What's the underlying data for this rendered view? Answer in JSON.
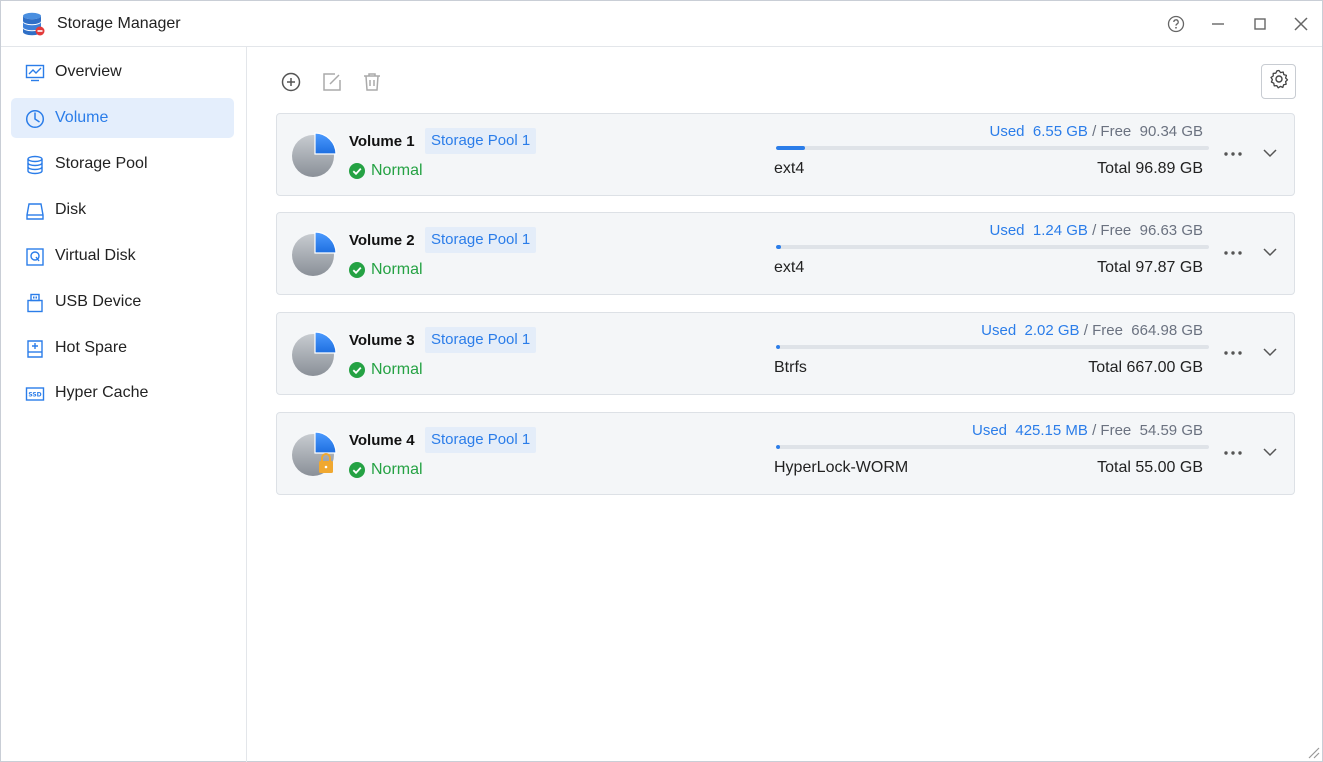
{
  "app": {
    "title": "Storage Manager",
    "icon": "database-icon"
  },
  "window_controls": {
    "help": "help-icon",
    "minimize": "minimize-icon",
    "maximize": "maximize-icon",
    "close": "close-icon"
  },
  "sidebar": {
    "items": [
      {
        "label": "Overview",
        "icon": "monitor-chart-icon",
        "active": false
      },
      {
        "label": "Volume",
        "icon": "pie-clock-icon",
        "active": true
      },
      {
        "label": "Storage Pool",
        "icon": "database-icon",
        "active": false
      },
      {
        "label": "Disk",
        "icon": "hard-drive-icon",
        "active": false
      },
      {
        "label": "Virtual Disk",
        "icon": "virtual-disk-icon",
        "active": false
      },
      {
        "label": "USB Device",
        "icon": "usb-icon",
        "active": false
      },
      {
        "label": "Hot Spare",
        "icon": "hot-spare-icon",
        "active": false
      },
      {
        "label": "Hyper Cache",
        "icon": "ssd-icon",
        "active": false
      }
    ]
  },
  "toolbar": {
    "add": "add-circle-icon",
    "edit": "edit-icon",
    "delete": "trash-icon",
    "settings": "gear-icon"
  },
  "colors": {
    "accent": "#2b7de9",
    "status_ok": "#25a244",
    "active_bg": "#e4eefc"
  },
  "volumes": [
    {
      "name": "Volume 1",
      "pool": "Storage Pool 1",
      "status": "Normal",
      "used_label": "Used",
      "used": "6.55 GB",
      "sep": "/",
      "free_label": "Free",
      "free": "90.34 GB",
      "fs": "ext4",
      "total_label": "Total",
      "total": "96.89 GB",
      "used_fraction": 0.0676,
      "locked": false
    },
    {
      "name": "Volume 2",
      "pool": "Storage Pool 1",
      "status": "Normal",
      "used_label": "Used",
      "used": "1.24 GB",
      "sep": "/",
      "free_label": "Free",
      "free": "96.63 GB",
      "fs": "ext4",
      "total_label": "Total",
      "total": "97.87 GB",
      "used_fraction": 0.0127,
      "locked": false
    },
    {
      "name": "Volume 3",
      "pool": "Storage Pool 1",
      "status": "Normal",
      "used_label": "Used",
      "used": "2.02 GB",
      "sep": "/",
      "free_label": "Free",
      "free": "664.98 GB",
      "fs": "Btrfs",
      "total_label": "Total",
      "total": "667.00 GB",
      "used_fraction": 0.003,
      "locked": false
    },
    {
      "name": "Volume 4",
      "pool": "Storage Pool 1",
      "status": "Normal",
      "used_label": "Used",
      "used": "425.15 MB",
      "sep": "/",
      "free_label": "Free",
      "free": "54.59 GB",
      "fs": "HyperLock-WORM",
      "total_label": "Total",
      "total": "55.00 GB",
      "used_fraction": 0.0077,
      "locked": true
    }
  ]
}
